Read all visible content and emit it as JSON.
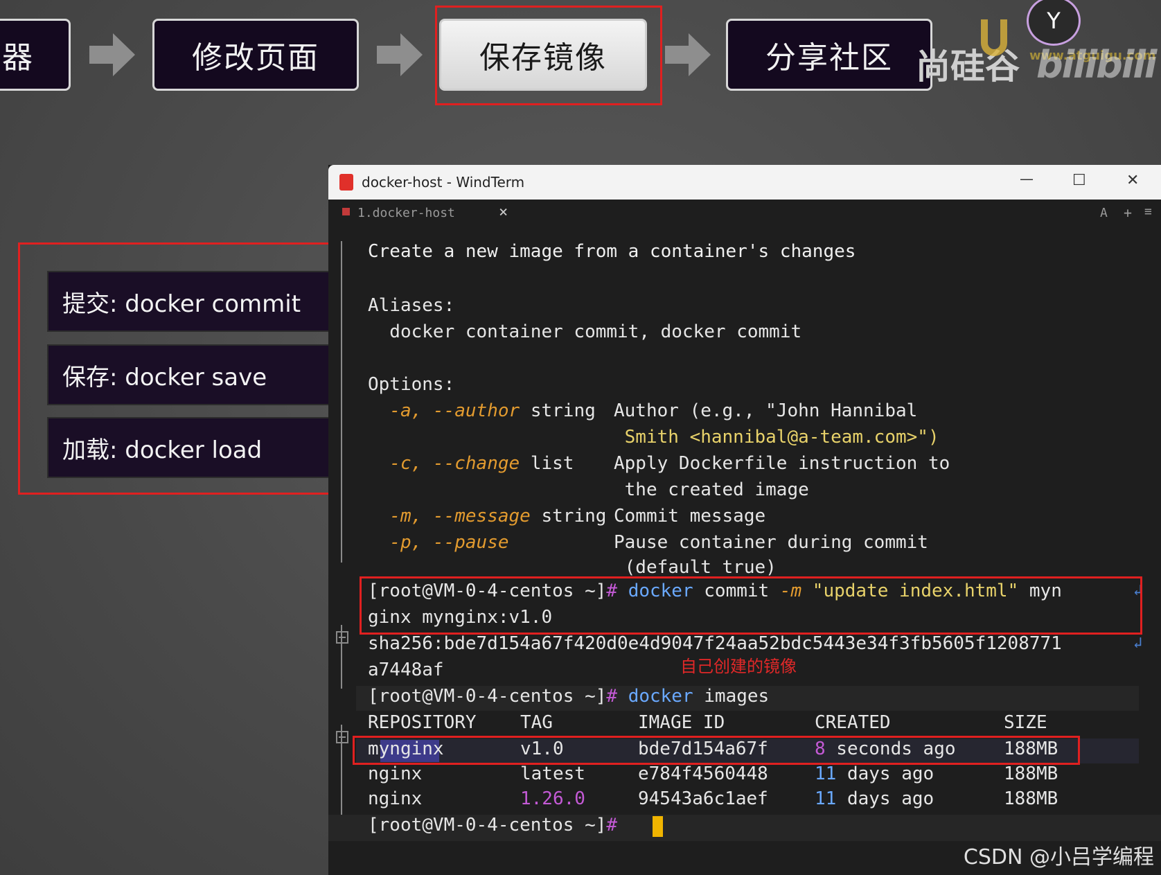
{
  "steps": [
    {
      "label": "器"
    },
    {
      "label": "修改页面"
    },
    {
      "label": "保存镜像"
    },
    {
      "label": "分享社区"
    }
  ],
  "brand": {
    "name": "尚硅谷",
    "url_watermark": "www.atguigu.com",
    "site_watermark": "bilibili"
  },
  "commands": [
    {
      "label": "提交:  docker commit"
    },
    {
      "label": "保存:  docker save"
    },
    {
      "label": "加载:  docker load"
    }
  ],
  "window": {
    "title": "docker-host - WindTerm",
    "tab_label": "1.docker-host",
    "tab_close": "×",
    "tab_actions": [
      "A",
      "+",
      "≡"
    ],
    "controls": {
      "minimize": "—",
      "maximize": "☐",
      "close": "✕"
    }
  },
  "terminal": {
    "description": "Create a new image from a container's changes",
    "aliases_header": "Aliases:",
    "aliases": "  docker container commit, docker commit",
    "options_header": "Options:",
    "options": [
      {
        "flag_short": "-a,",
        "flag_long": "--author",
        "type": "string",
        "desc": "Author (e.g., \"John Hannibal",
        "desc2": " Smith <hannibal@a-team.com>\")"
      },
      {
        "flag_short": "-c,",
        "flag_long": "--change",
        "type": "list",
        "desc": "Apply Dockerfile instruction to",
        "desc2": " the created image"
      },
      {
        "flag_short": "-m,",
        "flag_long": "--message",
        "type": "string",
        "desc": "Commit message",
        "desc2": ""
      },
      {
        "flag_short": "-p,",
        "flag_long": "--pause",
        "type": "",
        "desc": "Pause container during commit",
        "desc2": " (default true)"
      }
    ],
    "prompt": "[root@VM-0-4-centos ~]",
    "prompt_symbol": "#",
    "commit_cmd_a": "docker",
    "commit_cmd_b": " commit ",
    "commit_flag": "-m",
    "commit_msg": " \"update index.html\"",
    "commit_rest": " myn",
    "commit_cont": "ginx myngin",
    "commit_cont_tag": "x:v1.0",
    "sha_line1": "sha256:bde7d154a67f420d0e4d9047f24aa52bdc5443e34f3fb5605f1208771",
    "sha_line2": "a7448af",
    "annotation": "自己创建的镜像",
    "images_cmd_a": "docker",
    "images_cmd_b": " images",
    "table_headers": [
      "REPOSITORY",
      "TAG",
      "IMAGE ID",
      "CREATED",
      "SIZE"
    ],
    "rows": [
      {
        "repo": "mynginx",
        "tag": "v1.0",
        "id": "bde7d154a67f",
        "created_num": "8",
        "created_rest": " seconds ago",
        "size": "188MB"
      },
      {
        "repo": "nginx",
        "tag": "latest",
        "id": "e784f4560448",
        "created_num": "11",
        "created_rest": " days ago",
        "size": "188MB"
      },
      {
        "repo": "nginx",
        "tag": "1.26.0",
        "id": "94543a6c1aef",
        "created_num": "11",
        "created_rest": " days ago",
        "size": "188MB"
      }
    ]
  },
  "watermark": "CSDN @小吕学编程"
}
